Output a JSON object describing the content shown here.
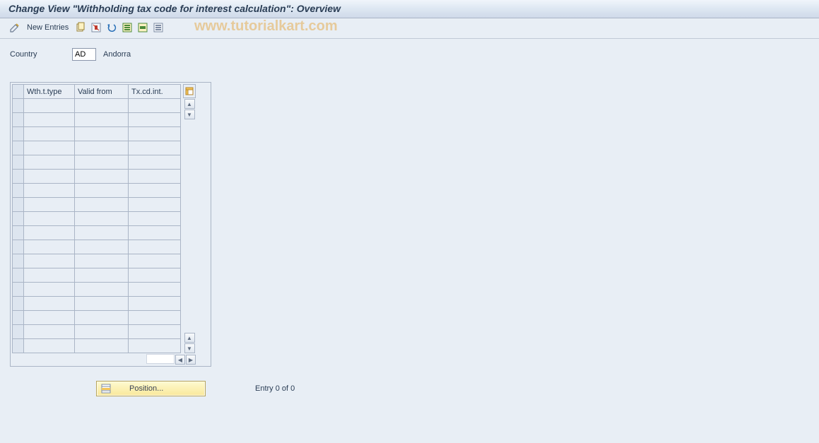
{
  "title": "Change View \"Withholding tax code for interest calculation\": Overview",
  "toolbar": {
    "pencil_name": "change-icon",
    "new_entries_label": "New Entries",
    "copy_name": "copy-icon",
    "delete_name": "delete-icon",
    "undo_name": "undo-icon",
    "select_all_name": "select-all-icon",
    "select_block_name": "select-block-icon",
    "deselect_name": "deselect-icon"
  },
  "watermark": "www.tutorialkart.com",
  "country": {
    "label": "Country",
    "value": "AD",
    "name": "Andorra"
  },
  "grid": {
    "columns": [
      "Wth.t.type",
      "Valid from",
      "Tx.cd.int."
    ],
    "row_count": 18
  },
  "position_button": {
    "label": "Position..."
  },
  "entry_status": "Entry 0 of 0"
}
